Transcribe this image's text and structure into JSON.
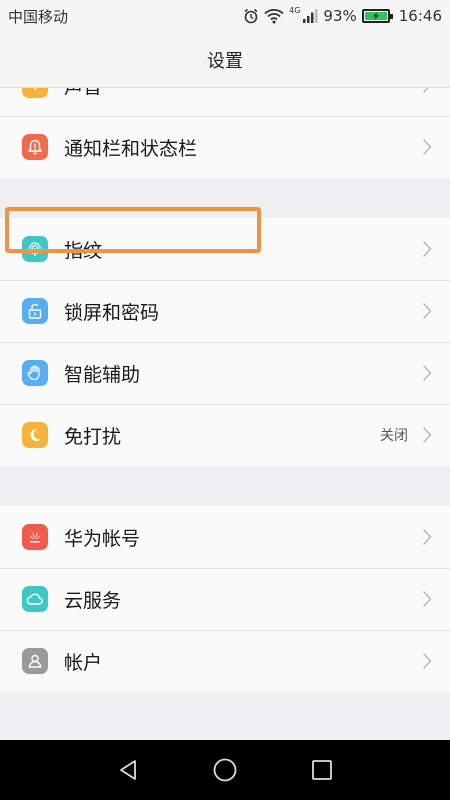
{
  "status": {
    "carrier": "中国移动",
    "network_type": "4G",
    "battery_percent": "93%",
    "time": "16:46"
  },
  "header": {
    "title": "设置"
  },
  "groups": [
    [
      {
        "label": "声音",
        "icon": "speaker-icon",
        "color": "#f5b53c"
      },
      {
        "label": "通知栏和状态栏",
        "icon": "bell-icon",
        "color": "#ef6b4c"
      }
    ],
    [
      {
        "label": "指纹",
        "icon": "fingerprint-icon",
        "color": "#3ec7c5"
      },
      {
        "label": "锁屏和密码",
        "icon": "lock-icon",
        "color": "#58aef0"
      },
      {
        "label": "智能辅助",
        "icon": "hand-icon",
        "color": "#58aef0"
      },
      {
        "label": "免打扰",
        "icon": "moon-icon",
        "color": "#f5b53c",
        "value": "关闭"
      }
    ],
    [
      {
        "label": "华为帐号",
        "icon": "huawei-logo-icon",
        "color": "#ef5a4c"
      },
      {
        "label": "云服务",
        "icon": "cloud-icon",
        "color": "#3ec7c5"
      },
      {
        "label": "帐户",
        "icon": "person-icon",
        "color": "#9a9a9a"
      }
    ]
  ],
  "colors": {
    "highlight": "#f0934a",
    "background": "#efeff1",
    "nav_bar": "#000000"
  }
}
